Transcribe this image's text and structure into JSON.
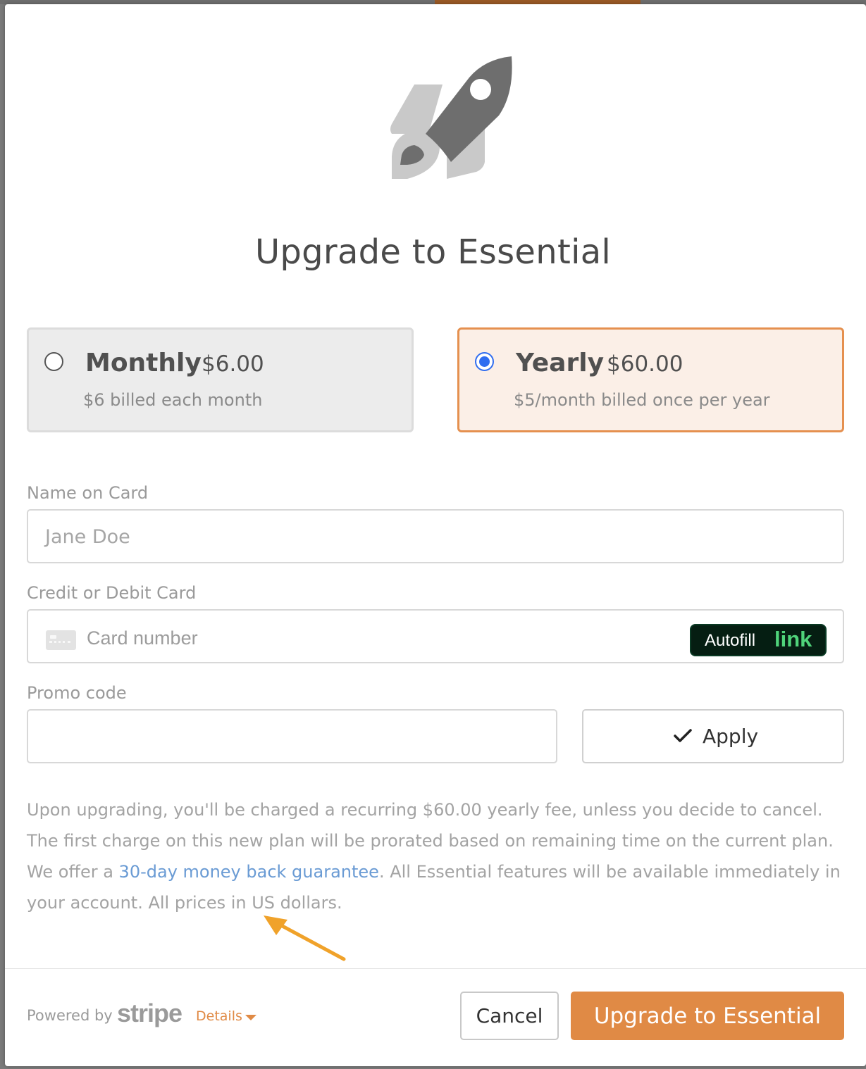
{
  "modal": {
    "title": "Upgrade to Essential"
  },
  "plans": [
    {
      "name": "Monthly",
      "price": "$6.00",
      "subtitle": "$6 billed each month",
      "selected": false
    },
    {
      "name": "Yearly",
      "price": "$60.00",
      "subtitle": "$5/month billed once per year",
      "selected": true
    }
  ],
  "form": {
    "name_label": "Name on Card",
    "name_placeholder": "Jane Doe",
    "card_label": "Credit or Debit Card",
    "card_placeholder": "Card number",
    "autofill_text": "Autofill",
    "autofill_link": "link",
    "promo_label": "Promo code",
    "promo_value": "",
    "apply_label": "Apply"
  },
  "disclaimer": {
    "part1": "Upon upgrading, you'll be charged a recurring $60.00 yearly fee, unless you decide to cancel. The first charge on this new plan will be prorated based on remaining time on the current plan. We offer a ",
    "link_text": "30-day money back guarantee",
    "part2": ". All Essential features will be available immediately in your account. All prices in US dollars."
  },
  "footer": {
    "powered_by": "Powered by",
    "stripe_logo": "stripe",
    "details_label": "Details",
    "cancel_label": "Cancel",
    "upgrade_label": "Upgrade to Essential"
  },
  "colors": {
    "accent": "#e08a45",
    "selected_radio": "#2f6df0",
    "link": "#6a9bd4",
    "autofill_bg": "#051e12",
    "autofill_link": "#4fd37a"
  },
  "icons": {
    "hero": "rocket-icon",
    "card": "credit-card-icon",
    "apply": "check-icon",
    "details": "caret-down-icon",
    "annotation": "arrow-annotation"
  }
}
